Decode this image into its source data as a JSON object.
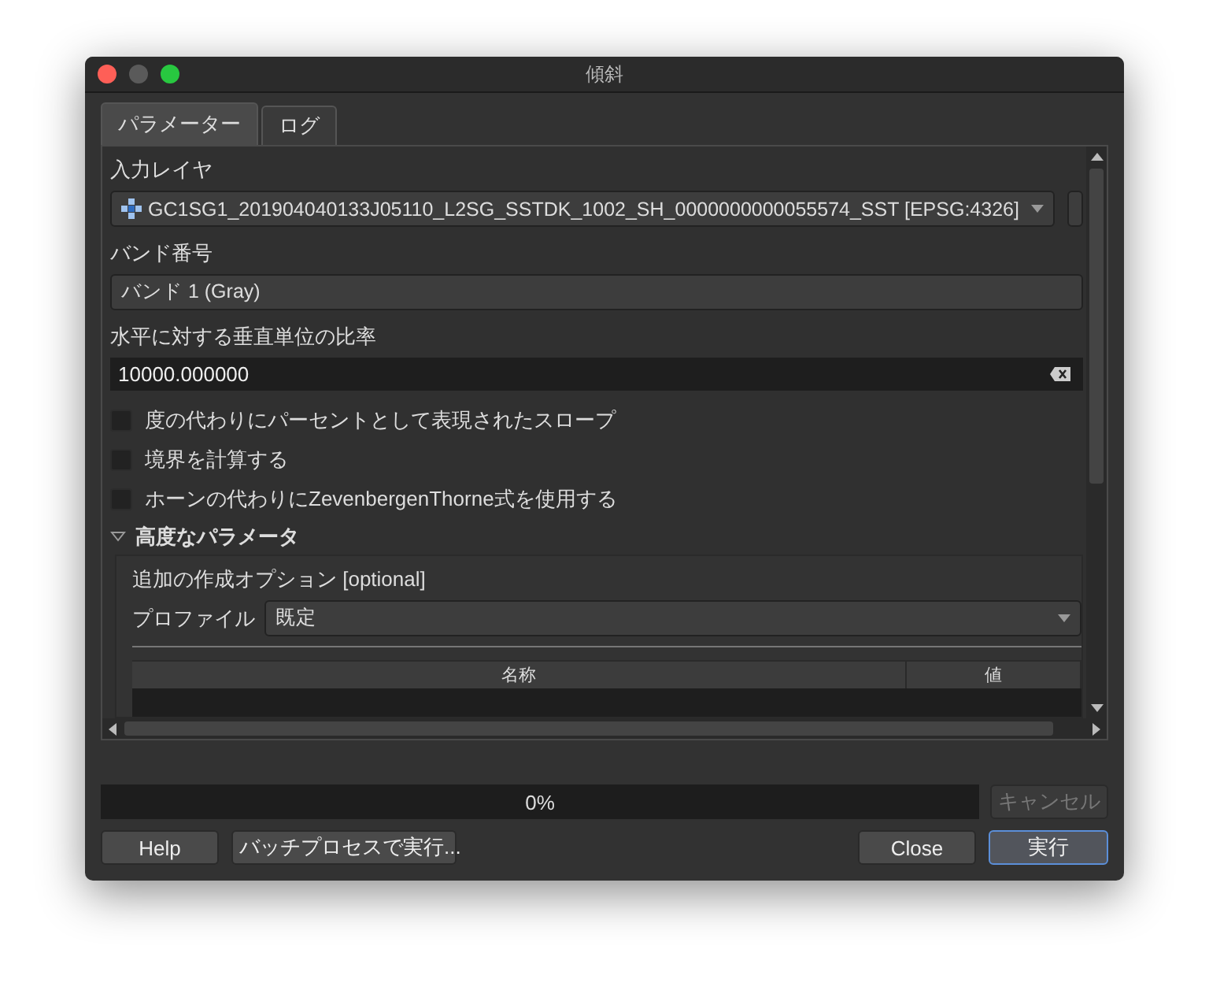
{
  "window": {
    "title": "傾斜"
  },
  "tabs": [
    {
      "label": "パラメーター",
      "selected": true
    },
    {
      "label": "ログ",
      "selected": false
    }
  ],
  "input_layer": {
    "label": "入力レイヤ",
    "value": "GC1SG1_201904040133J05110_L2SG_SSTDK_1002_SH_0000000000055574_SST [EPSG:4326]"
  },
  "band": {
    "label": "バンド番号",
    "value": "バンド 1 (Gray)"
  },
  "ratio": {
    "label": "水平に対する垂直単位の比率",
    "value": "10000.000000"
  },
  "checkboxes": [
    {
      "label": "度の代わりにパーセントとして表現されたスロープ",
      "checked": false
    },
    {
      "label": "境界を計算する",
      "checked": false
    },
    {
      "label": "ホーンの代わりにZevenbergenThorne式を使用する",
      "checked": false
    }
  ],
  "advanced": {
    "title": "高度なパラメータ",
    "expanded": true,
    "options_label": "追加の作成オプション [optional]",
    "profile_label": "プロファイル",
    "profile_value": "既定",
    "table_columns": [
      "名称",
      "値"
    ]
  },
  "progress": {
    "level": 0,
    "text": "0%"
  },
  "cancel_button": {
    "label": "キャンセル",
    "disabled": true
  },
  "buttons": [
    {
      "label": "Help",
      "kind": "normal"
    },
    {
      "label": "バッチプロセスで実行...",
      "kind": "normal"
    },
    {
      "label": "Close",
      "kind": "normal"
    },
    {
      "label": "実行",
      "kind": "default"
    }
  ]
}
